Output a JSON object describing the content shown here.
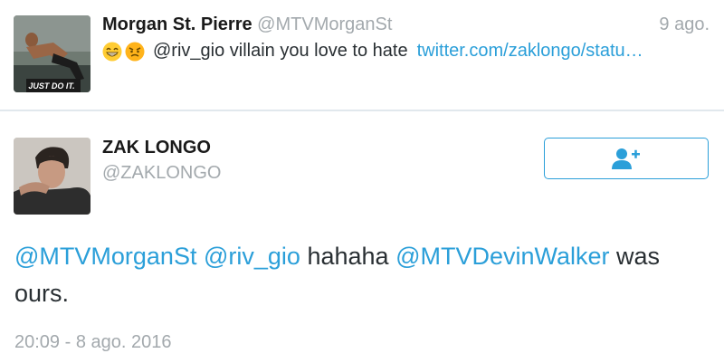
{
  "quoted_tweet": {
    "name": "Morgan St. Pierre",
    "handle": "@MTVMorganSt",
    "time": "9 ago.",
    "emojis": [
      "grinning-face-emoji",
      "angry-face-emoji"
    ],
    "text": "@riv_gio villain you love to hate",
    "link": "twitter.com/zaklongo/statu…",
    "avatar_caption": "JUST DO IT."
  },
  "main_tweet": {
    "name": "ZAK LONGO",
    "handle": "@ZAKLONGO",
    "follow_icon": "add-user-icon",
    "mention1": "@MTVMorganSt",
    "mention2": "@riv_gio",
    "text_mid": "hahaha",
    "mention3": "@MTVDevinWalker",
    "text_end": "was ours.",
    "timestamp": "20:09 - 8 ago. 2016"
  },
  "colors": {
    "link": "#2b9fd9",
    "secondary_text": "#a3a9ad",
    "divider": "#e1e8ed"
  }
}
